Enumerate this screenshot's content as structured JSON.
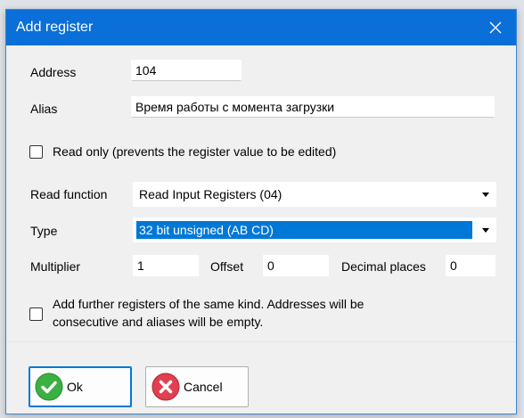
{
  "window": {
    "title": "Add register",
    "close_icon": "close-icon"
  },
  "form": {
    "address": {
      "label": "Address",
      "value": "104"
    },
    "alias": {
      "label": "Alias",
      "value": "Время работы с момента загрузки"
    },
    "read_only": {
      "label": "Read only (prevents the register value to be edited)",
      "checked": false
    },
    "read_function": {
      "label": "Read function",
      "value": "Read Input Registers (04)"
    },
    "type": {
      "label": "Type",
      "value": "32 bit unsigned (AB CD)"
    },
    "multiplier": {
      "label": "Multiplier",
      "value": "1"
    },
    "offset": {
      "label": "Offset",
      "value": "0"
    },
    "decimal_places": {
      "label": "Decimal places",
      "value": "0"
    },
    "add_further": {
      "line1": "Add further registers of the same kind. Addresses will be",
      "line2": "consecutive and aliases will be empty.",
      "checked": false
    }
  },
  "buttons": {
    "ok": {
      "label": "Ok",
      "icon": "check-circle-icon",
      "color": "#3cb043"
    },
    "cancel": {
      "label": "Cancel",
      "icon": "x-circle-icon",
      "color": "#e04050"
    }
  },
  "colors": {
    "titlebar": "#0a6fd8",
    "selection": "#0078d7"
  }
}
